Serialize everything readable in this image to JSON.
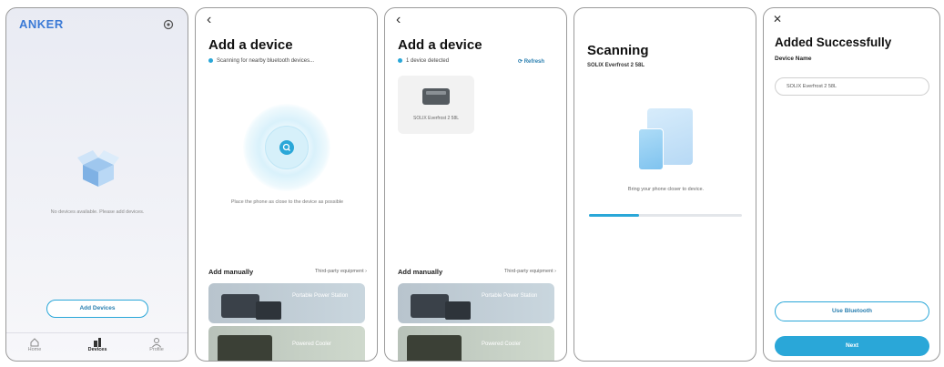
{
  "screen1": {
    "logo": "ANKER",
    "empty_text": "No devices available. Please add devices.",
    "add_button": "Add Devices",
    "nav": [
      {
        "label": "Home",
        "icon": "home-icon"
      },
      {
        "label": "Devices",
        "icon": "devices-icon"
      },
      {
        "label": "Profile",
        "icon": "profile-icon"
      }
    ]
  },
  "screen2": {
    "title": "Add a device",
    "status": "Scanning for nearby bluetooth devices...",
    "hint": "Place the phone as close to the device as possible",
    "add_manually": "Add manually",
    "third_party": "Third-party equipment ›",
    "cards": [
      "Portable Power Station",
      "Powered Cooler"
    ]
  },
  "screen3": {
    "title": "Add a device",
    "status": "1 device detected",
    "refresh": "Refresh",
    "device_name": "SOLIX Everfrost 2 58L",
    "add_manually": "Add manually",
    "third_party": "Third-party equipment ›",
    "cards": [
      "Portable Power Station",
      "Powered Cooler"
    ]
  },
  "screen4": {
    "title": "Scanning",
    "device": "SOLIX Everfrost 2 58L",
    "hint": "Bring your phone closer to device.",
    "progress": 0.33
  },
  "screen5": {
    "title": "Added Successfully",
    "device_name_label": "Device Name",
    "device_name_value": "SOLIX Everfrost 2 58L",
    "use_bluetooth": "Use Bluetooth",
    "next": "Next"
  },
  "colors": {
    "accent": "#2aa7d8",
    "logo": "#3b7ad6"
  }
}
